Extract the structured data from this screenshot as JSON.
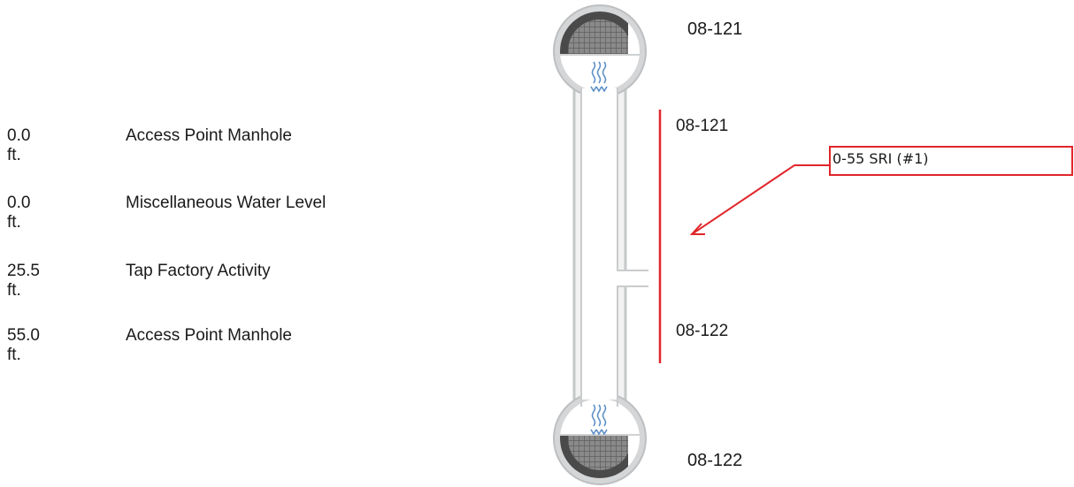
{
  "observations": [
    {
      "distance": "0.0 ft.",
      "description": "Access Point Manhole"
    },
    {
      "distance": "0.0 ft.",
      "description": "Miscellaneous Water Level"
    },
    {
      "distance": "25.5 ft.",
      "description": "Tap Factory Activity"
    },
    {
      "distance": "55.0 ft.",
      "description": "Access Point Manhole"
    }
  ],
  "manholes": {
    "upstream_label": "08-121",
    "downstream_label": "08-122"
  },
  "segment": {
    "start_label": "08-121",
    "end_label": "08-122"
  },
  "callout": {
    "text": "0-55 SRI (#1)",
    "color": "#e0262b"
  }
}
